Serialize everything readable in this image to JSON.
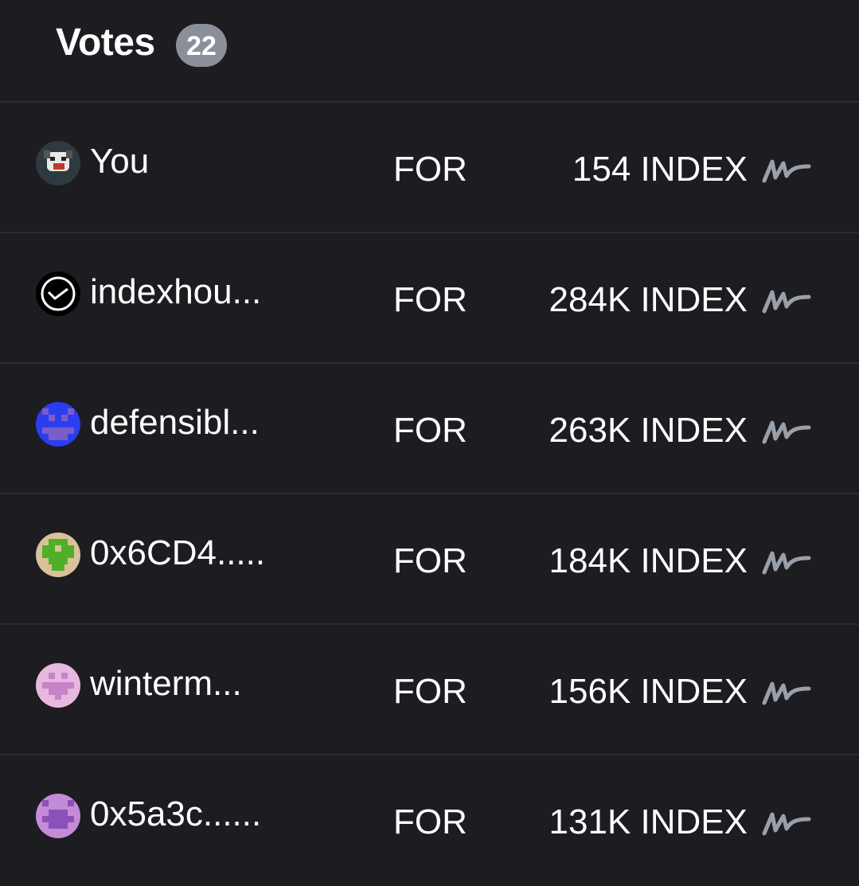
{
  "header": {
    "title": "Votes",
    "count": "22"
  },
  "votes": [
    {
      "voter": "You",
      "choice": "FOR",
      "weight": "154 INDEX",
      "avatar": "dog-avatar-icon"
    },
    {
      "voter": "indexhou...",
      "choice": "FOR",
      "weight": "284K INDEX",
      "avatar": "logo-avatar-icon"
    },
    {
      "voter": "defensibl...",
      "choice": "FOR",
      "weight": "263K INDEX",
      "avatar": "pixel-avatar-icon"
    },
    {
      "voter": "0x6CD4.....",
      "choice": "FOR",
      "weight": "184K INDEX",
      "avatar": "pixel-avatar-icon"
    },
    {
      "voter": "winterm...",
      "choice": "FOR",
      "weight": "156K INDEX",
      "avatar": "pixel-avatar-icon"
    },
    {
      "voter": "0x5a3c......",
      "choice": "FOR",
      "weight": "131K INDEX",
      "avatar": "pixel-avatar-icon"
    }
  ],
  "colors": {
    "background": "#1c1c21",
    "divider": "#2b2b31",
    "badge": "#8a8f99",
    "signature_icon": "#9aa0aa"
  }
}
